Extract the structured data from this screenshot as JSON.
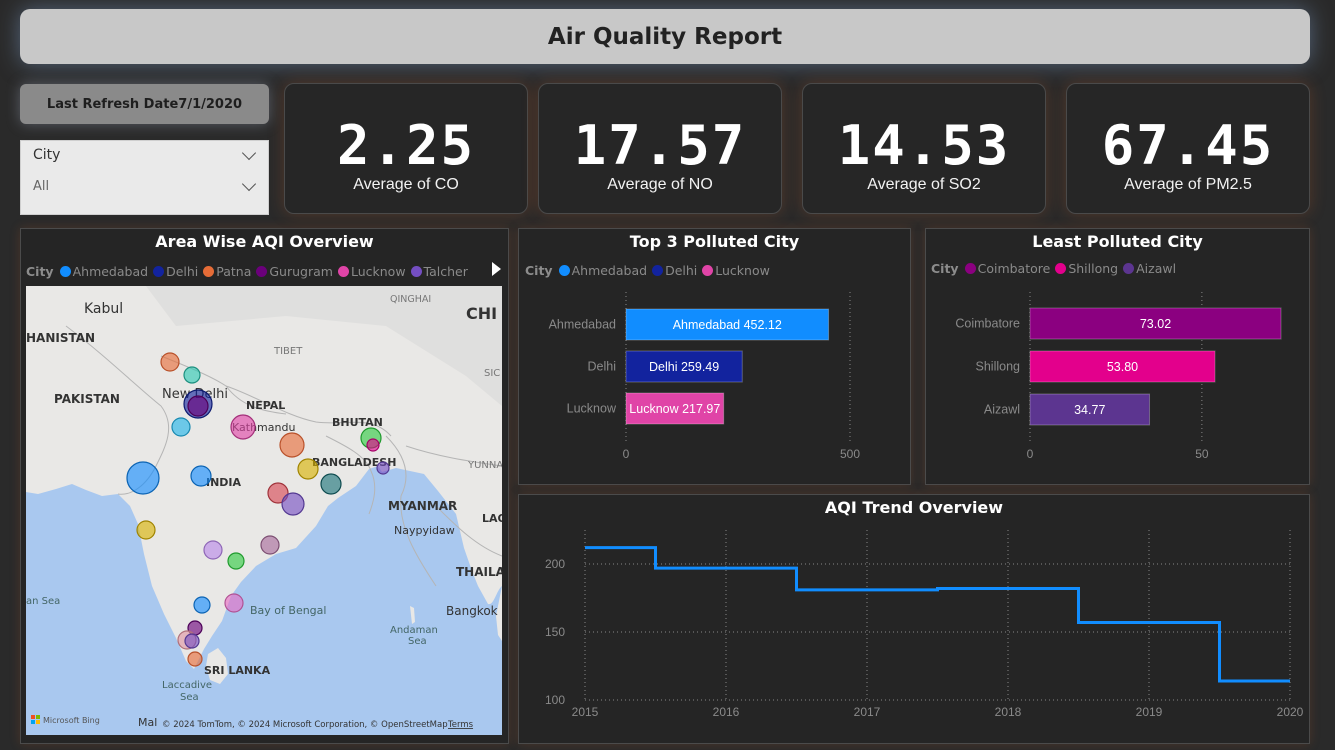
{
  "header": {
    "title": "Air Quality Report"
  },
  "refresh": {
    "label": "Last Refresh Date",
    "date": "7/1/2020"
  },
  "slicer": {
    "label": "City",
    "value": "All"
  },
  "kpis": [
    {
      "value": "2.25",
      "caption": "Average of CO"
    },
    {
      "value": "17.57",
      "caption": "Average of NO"
    },
    {
      "value": "14.53",
      "caption": "Average of SO2"
    },
    {
      "value": "67.45",
      "caption": "Average of PM2.5"
    }
  ],
  "map_panel": {
    "title": "Area Wise AQI Overview",
    "legend_title": "City",
    "legend": [
      {
        "name": "Ahmedabad",
        "color": "#118DFF"
      },
      {
        "name": "Delhi",
        "color": "#12239E"
      },
      {
        "name": "Patna",
        "color": "#E66C37"
      },
      {
        "name": "Gurugram",
        "color": "#6B007B"
      },
      {
        "name": "Lucknow",
        "color": "#E044A7"
      },
      {
        "name": "Talcher",
        "color": "#744EC2"
      }
    ],
    "labels": {
      "kabul": "Kabul",
      "hanistan": "HANISTAN",
      "pakistan": "PAKISTAN",
      "new_delhi": "New Delhi",
      "nepal": "NEPAL",
      "kathmandu": "Kathmandu",
      "tibet": "TIBET",
      "bhutan": "BHUTAN",
      "bangladesh": "BANGLADESH",
      "india": "INDIA",
      "myanmar": "MYANMAR",
      "naypyidaw": "Naypyidaw",
      "qinghai": "QINGHAI",
      "chi": "CHI",
      "sic": "SIC",
      "yunna": "YUNNA",
      "lao": "LAO",
      "thaila": "THAILA",
      "bangkok": "Bangkok",
      "bay_of_bengal": "Bay of Bengal",
      "andaman_sea_1": "Andaman",
      "andaman_sea_2": "Sea",
      "an_sea": "an Sea",
      "sri_lanka": "SRI LANKA",
      "laccadive_1": "Laccadive",
      "laccadive_2": "Sea",
      "mal": "Mal",
      "bing": "Microsoft Bing",
      "copyright": "© 2024 TomTom, © 2024 Microsoft Corporation, © OpenStreetMap",
      "terms": "Terms"
    }
  },
  "top3": {
    "title": "Top 3 Polluted City",
    "legend_title": "City",
    "legend": [
      {
        "name": "Ahmedabad",
        "color": "#118DFF"
      },
      {
        "name": "Delhi",
        "color": "#12239E"
      },
      {
        "name": "Lucknow",
        "color": "#E044A7"
      }
    ]
  },
  "least": {
    "title": "Least Polluted City",
    "legend_title": "City",
    "legend": [
      {
        "name": "Coimbatore",
        "color": "#8B0080"
      },
      {
        "name": "Shillong",
        "color": "#E3008C"
      },
      {
        "name": "Aizawl",
        "color": "#5C3590"
      }
    ]
  },
  "trend": {
    "title": "AQI Trend Overview"
  },
  "chart_data": [
    {
      "type": "bar",
      "orientation": "horizontal",
      "title": "Top 3 Polluted City",
      "categories": [
        "Ahmedabad",
        "Delhi",
        "Lucknow"
      ],
      "values": [
        452.12,
        259.49,
        217.97
      ],
      "data_labels": [
        "Ahmedabad 452.12",
        "Delhi 259.49",
        "Lucknow 217.97"
      ],
      "colors": [
        "#118DFF",
        "#12239E",
        "#E044A7"
      ],
      "xlim": [
        0,
        500
      ],
      "xticks": [
        "0",
        "500"
      ],
      "grid": true
    },
    {
      "type": "bar",
      "orientation": "horizontal",
      "title": "Least Polluted City",
      "categories": [
        "Coimbatore",
        "Shillong",
        "Aizawl"
      ],
      "values": [
        73.02,
        53.8,
        34.77
      ],
      "data_labels": [
        "73.02",
        "53.80",
        "34.77"
      ],
      "colors": [
        "#8B0080",
        "#E3008C",
        "#5C3590"
      ],
      "xlim": [
        0,
        80
      ],
      "xticks": [
        "0",
        "50"
      ],
      "grid": true
    },
    {
      "type": "line",
      "title": "AQI Trend Overview",
      "x": [
        2015,
        2015.5,
        2015.5,
        2016.5,
        2016.5,
        2017.5,
        2017.5,
        2018.5,
        2018.5,
        2019.5,
        2019.5,
        2020
      ],
      "y": [
        212,
        212,
        197,
        197,
        181,
        181,
        182,
        182,
        157,
        157,
        114,
        114
      ],
      "xticks": [
        "2015",
        "2016",
        "2017",
        "2018",
        "2019",
        "2020"
      ],
      "yticks": [
        "100",
        "150",
        "200"
      ],
      "xlim": [
        2015,
        2020
      ],
      "ylim": [
        100,
        225
      ],
      "color": "#118DFF",
      "grid": true
    }
  ]
}
